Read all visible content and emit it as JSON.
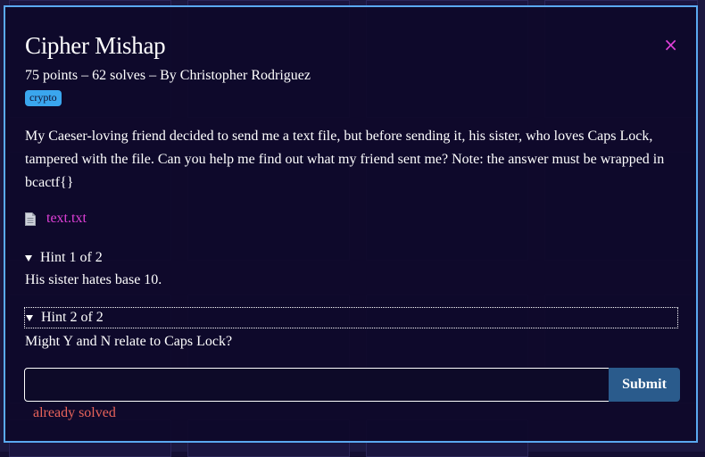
{
  "challenge": {
    "title": "Cipher Mishap",
    "meta": "75 points – 62 solves – By Christopher Rodriguez",
    "tag": "crypto",
    "description": "My Caeser-loving friend decided to send me a text file, but before sending it, his sister, who loves Caps Lock, tampered with the file. Can you help me find out what my friend sent me? Note: the answer must be wrapped in bcactf{}",
    "file_name": "text.txt",
    "close_icon": "×"
  },
  "hints": [
    {
      "label": "Hint 1 of 2",
      "text": "His sister hates base 10."
    },
    {
      "label": "Hint 2 of 2",
      "text": "Might Y and N relate to Caps Lock?"
    }
  ],
  "form": {
    "answer_value": "",
    "answer_placeholder": "",
    "submit_label": "Submit",
    "status": "already solved"
  },
  "colors": {
    "accent_border": "#5aa9f0",
    "link": "#e040d8",
    "tag": "#3aa6ee",
    "submit": "#2a5b8c",
    "status": "#e8635a"
  }
}
